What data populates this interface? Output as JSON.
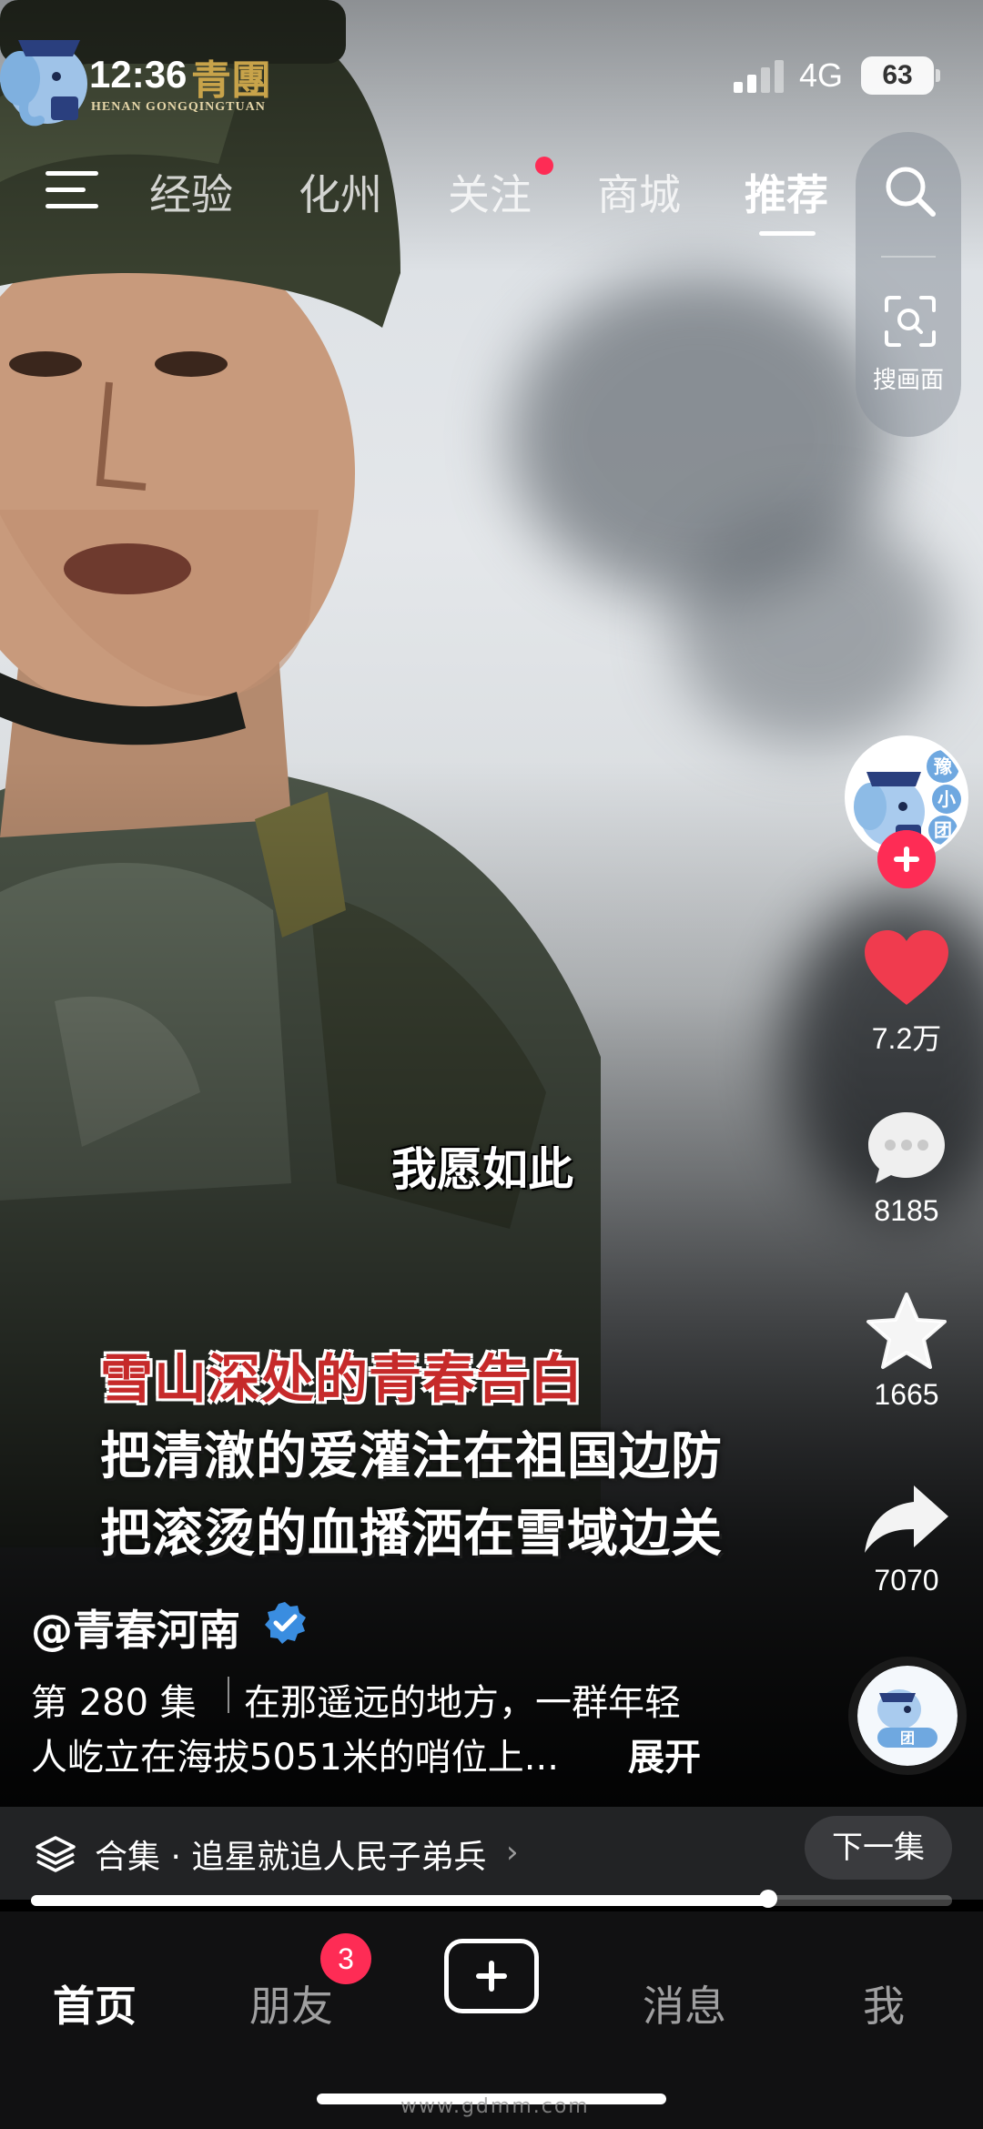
{
  "status_bar": {
    "time": "12:36",
    "watermark_cn": "青團",
    "watermark_en": "HENAN GONGQINGTUAN",
    "network": "4G",
    "battery": "63"
  },
  "top_nav": {
    "tabs": [
      {
        "label": "经验",
        "active": false
      },
      {
        "label": "化州",
        "active": false
      },
      {
        "label": "关注",
        "active": false,
        "has_dot": true
      },
      {
        "label": "商城",
        "active": false
      },
      {
        "label": "推荐",
        "active": true
      }
    ],
    "search_icon": "search-icon",
    "scan_label": "搜画面"
  },
  "video": {
    "subtitle": "我愿如此",
    "title_red": "雪山深处的青春告白",
    "title_lines": [
      "把清澈的爱灌注在祖国边防",
      "把滚烫的血播洒在雪域边关"
    ]
  },
  "actions": {
    "avatar_label": "豫小团",
    "likes": "7.2万",
    "comments": "8185",
    "favorites": "1665",
    "shares": "7070",
    "disc_label": "团"
  },
  "post": {
    "author": "@青春河南",
    "episode": "第 280 集",
    "description_line1": "在那遥远的地方，一群年轻",
    "description_line2": "人屹立在海拔5051米的哨位上...",
    "expand": "展开"
  },
  "collection": {
    "label": "合集 · 追星就追人民子弟兵",
    "arrow": "›",
    "next_button": "下一集",
    "progress": 0.8
  },
  "tab_bar": {
    "tabs": [
      "首页",
      "朋友",
      "消息",
      "我"
    ],
    "friends_badge": "3"
  },
  "colors": {
    "accent_red": "#fe2c55",
    "verified_blue": "#3a8de0",
    "like_red": "#f03b4e"
  },
  "footer_watermark": "www.gdmm.com"
}
